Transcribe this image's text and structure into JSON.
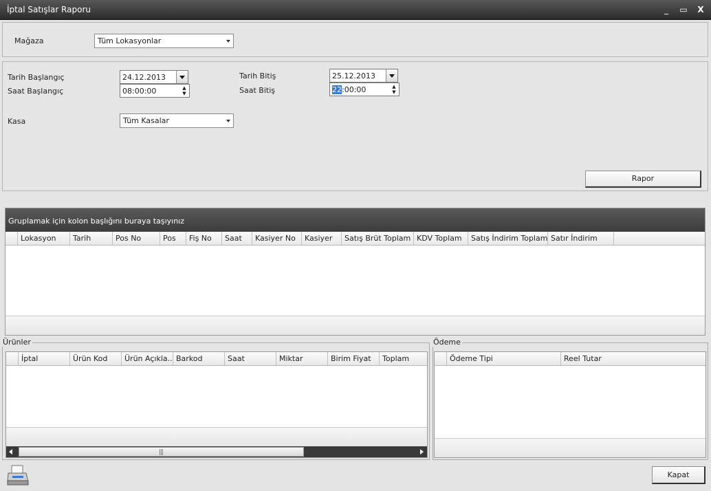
{
  "window": {
    "title": "İptal Satışlar Raporu",
    "minimize": "_",
    "maximize": "▭",
    "close": "X"
  },
  "store": {
    "label": "Mağaza",
    "value": "Tüm Lokasyonlar"
  },
  "filters": {
    "start_date_label": "Tarih Başlangıç",
    "start_date": "24.12.2013",
    "start_time_label": "Saat Başlangıç",
    "start_time": "08:00:00",
    "end_date_label": "Tarih Bitiş",
    "end_date": "25.12.2013",
    "end_time_label": "Saat Bitiş",
    "end_time_selected": "22",
    "end_time_rest": ":00:00",
    "register_label": "Kasa",
    "register_value": "Tüm Kasalar",
    "report_button": "Rapor"
  },
  "main_grid": {
    "group_hint": "Gruplamak için kolon başlığını buraya taşıyınız",
    "columns": [
      "Lokasyon",
      "Tarih",
      "Pos No",
      "Pos",
      "Fiş No",
      "Saat",
      "Kasiyer No",
      "Kasiyer",
      "Satış Brüt Toplam",
      "KDV Toplam",
      "Satış İndirim Toplam",
      "Satır İndirim"
    ]
  },
  "products": {
    "legend": "Ürünler",
    "columns": [
      "İptal",
      "Ürün Kod",
      "Ürün Açıkla...",
      "Barkod",
      "Saat",
      "Miktar",
      "Birim Fiyat",
      "Toplam"
    ],
    "scroll_grip": "|||"
  },
  "payment": {
    "legend": "Ödeme",
    "columns": [
      "Ödeme Tipi",
      "Reel Tutar"
    ]
  },
  "bottom": {
    "close_button": "Kapat"
  },
  "icons": {
    "printer": "printer-icon",
    "dropdown": "chevron-down-icon"
  }
}
